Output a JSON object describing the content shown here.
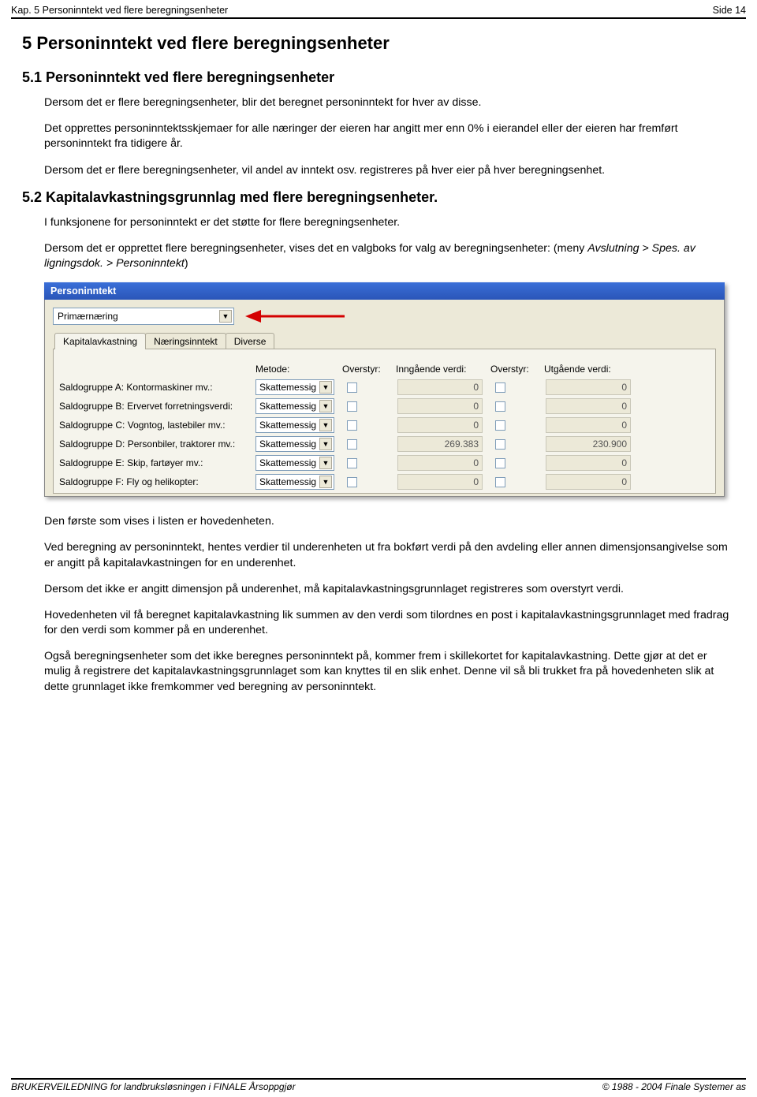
{
  "header": {
    "chapter": "Kap. 5 Personinntekt ved flere beregningsenheter",
    "page": "Side 14"
  },
  "section1": {
    "title": "5  Personinntekt ved flere beregningsenheter",
    "sub_title": "5.1  Personinntekt ved flere beregningsenheter",
    "p1": "Dersom det er flere beregningsenheter, blir det beregnet personinntekt for hver av disse.",
    "p2": "Det opprettes personinntektsskjemaer for alle næringer der eieren har angitt mer enn 0% i eierandel eller der eieren har fremført personinntekt fra tidigere år.",
    "p3": "Dersom det er flere beregningsenheter, vil andel av inntekt osv. registreres på hver eier på hver beregningsenhet."
  },
  "section2": {
    "title": "5.2  Kapitalavkastningsgrunnlag med flere beregningsenheter.",
    "p1": "I funksjonene for personinntekt er det støtte for flere beregningsenheter.",
    "p2_a": "Dersom det er opprettet flere beregningsenheter, vises det en valgboks for valg av beregningsenheter: (meny ",
    "p2_menu": "Avslutning > Spes. av ligningsdok. > Personinntekt",
    "p2_b": ")",
    "p3": "Den første som vises i listen er hovedenheten.",
    "p4": "Ved beregning av personinntekt, hentes verdier til underenheten ut fra bokført verdi på den avdeling eller annen dimensjonsangivelse som er angitt på kapitalavkastningen for en underenhet.",
    "p5": "Dersom det ikke er angitt dimensjon på underenhet, må kapitalavkastningsgrunnlaget registreres som overstyrt verdi.",
    "p6": "Hovedenheten vil få beregnet kapitalavkastning lik summen av den verdi som tilordnes en post i kapitalavkastningsgrunnlaget med fradrag for den verdi som kommer på en underenhet.",
    "p7": "Også beregningsenheter som det ikke beregnes personinntekt på, kommer frem i skillekortet for kapitalavkastning. Dette gjør at det er mulig å registrere det kapitalavkastningsgrunnlaget som kan knyttes til en slik enhet. Denne vil så bli trukket fra på hovedenheten slik at dette grunnlaget ikke fremkommer ved beregning av personinntekt."
  },
  "screenshot": {
    "title": "Personinntekt",
    "dropdown_value": "Primærnæring",
    "tabs": [
      "Kapitalavkastning",
      "Næringsinntekt",
      "Diverse"
    ],
    "columns": {
      "metode": "Metode:",
      "overstyr1": "Overstyr:",
      "inngaende": "Inngående verdi:",
      "overstyr2": "Overstyr:",
      "utgaende": "Utgående verdi:"
    },
    "method_value": "Skattemessig",
    "rows": [
      {
        "label": "Saldogruppe A: Kontormaskiner mv.:",
        "in": "0",
        "out": "0",
        "readonly": true
      },
      {
        "label": "Saldogruppe B: Ervervet forretningsverdi:",
        "in": "0",
        "out": "0",
        "readonly": true
      },
      {
        "label": "Saldogruppe C: Vogntog, lastebiler mv.:",
        "in": "0",
        "out": "0",
        "readonly": true
      },
      {
        "label": "Saldogruppe D: Personbiler, traktorer mv.:",
        "in": "269.383",
        "out": "230.900",
        "readonly": true
      },
      {
        "label": "Saldogruppe E: Skip, fartøyer mv.:",
        "in": "0",
        "out": "0",
        "readonly": true
      },
      {
        "label": "Saldogruppe F: Fly og helikopter:",
        "in": "0",
        "out": "0",
        "readonly": true
      }
    ]
  },
  "footer": {
    "left": "BRUKERVEILEDNING for landbruksløsningen i FINALE Årsoppgjør",
    "right": "© 1988 - 2004 Finale Systemer as"
  }
}
